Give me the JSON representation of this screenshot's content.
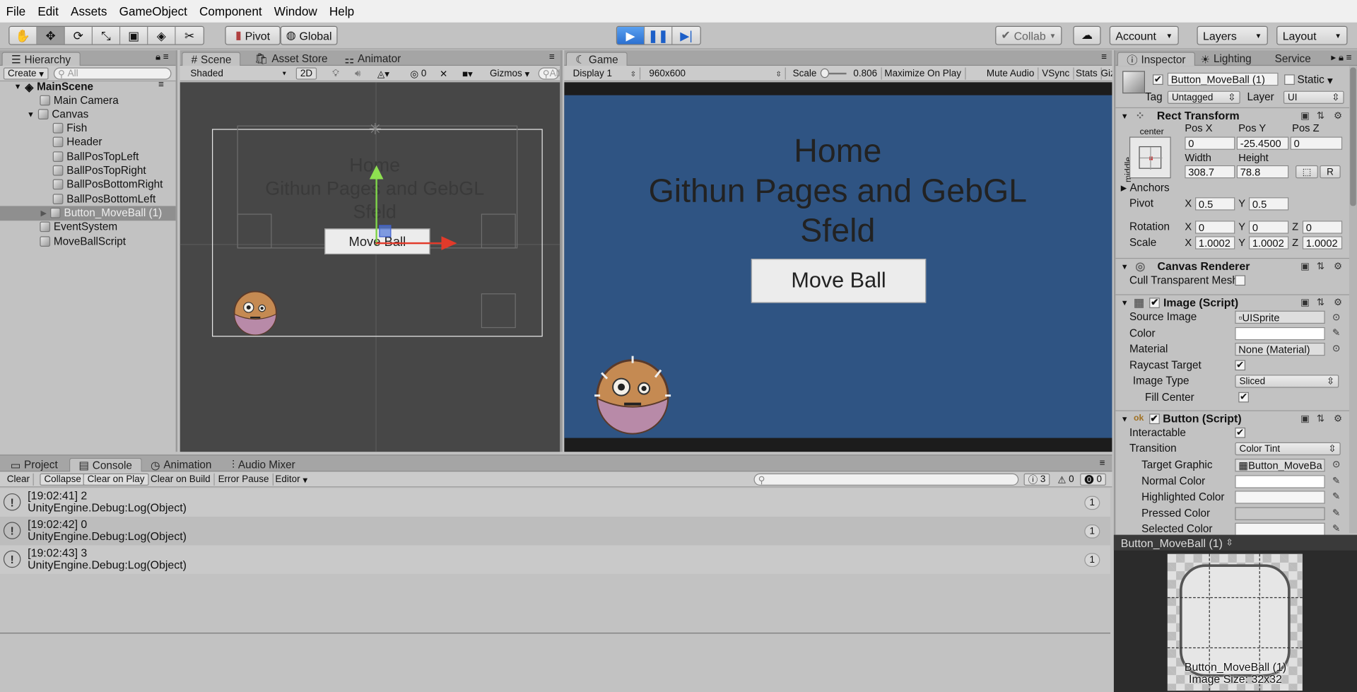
{
  "menu": [
    "File",
    "Edit",
    "Assets",
    "GameObject",
    "Component",
    "Window",
    "Help"
  ],
  "toolbar": {
    "pivot": "Pivot",
    "global": "Global",
    "collab": "Collab",
    "account": "Account",
    "layers": "Layers",
    "layout": "Layout"
  },
  "hierarchy": {
    "tab": "Hierarchy",
    "create": "Create",
    "search_placeholder": "All",
    "items": [
      {
        "label": "MainScene"
      },
      {
        "label": "Main Camera"
      },
      {
        "label": "Canvas"
      },
      {
        "label": "Fish"
      },
      {
        "label": "Header"
      },
      {
        "label": "BallPosTopLeft"
      },
      {
        "label": "BallPosTopRight"
      },
      {
        "label": "BallPosBottomRight"
      },
      {
        "label": "BallPosBottomLeft"
      },
      {
        "label": "Button_MoveBall (1)"
      },
      {
        "label": "EventSystem"
      },
      {
        "label": "MoveBallScript"
      }
    ]
  },
  "scene": {
    "tabs": [
      "Scene",
      "Asset Store",
      "Animator"
    ],
    "shading": "Shaded",
    "mode_2d": "2D",
    "effects_count": "0",
    "gizmos": "Gizmos",
    "search_placeholder": "All",
    "heading_line1": "Home",
    "heading_line2": "Githun Pages and GebGL",
    "heading_line3": "Sfeld",
    "button_label": "Move Ball"
  },
  "game": {
    "tab": "Game",
    "display": "Display 1",
    "resolution": "960x600",
    "scale_label": "Scale",
    "scale_value": "0.806",
    "toggles": [
      "Maximize On Play",
      "Mute Audio",
      "VSync",
      "Stats",
      "Gizmo"
    ],
    "heading_line1": "Home",
    "heading_line2": "Githun Pages and GebGL",
    "heading_line3": "Sfeld",
    "button_label": "Move Ball",
    "bg_color": "#2f5483"
  },
  "console": {
    "tabs": [
      "Project",
      "Console",
      "Animation",
      "Audio Mixer"
    ],
    "buttons": [
      "Clear",
      "Collapse",
      "Clear on Play",
      "Clear on Build",
      "Error Pause",
      "Editor"
    ],
    "counts": {
      "log": "3",
      "warn": "0",
      "error": "0"
    },
    "logs": [
      {
        "time": "[19:02:41] 2",
        "detail": "UnityEngine.Debug:Log(Object)",
        "count": "1"
      },
      {
        "time": "[19:02:42] 0",
        "detail": "UnityEngine.Debug:Log(Object)",
        "count": "1"
      },
      {
        "time": "[19:02:43] 3",
        "detail": "UnityEngine.Debug:Log(Object)",
        "count": "1"
      }
    ]
  },
  "inspector": {
    "tabs": [
      "Inspector",
      "Lighting",
      "Service"
    ],
    "object_name": "Button_MoveBall (1)",
    "static_label": "Static",
    "tag_label": "Tag",
    "tag_value": "Untagged",
    "layer_label": "Layer",
    "layer_value": "UI",
    "rect_transform": {
      "title": "Rect Transform",
      "anchor_h": "center",
      "anchor_v": "middle",
      "posx_label": "Pos X",
      "posy_label": "Pos Y",
      "posz_label": "Pos Z",
      "posx": "0",
      "posy": "-25.4500",
      "posz": "0",
      "width_label": "Width",
      "height_label": "Height",
      "width": "308.7",
      "height": "78.8",
      "r_btn": "R",
      "anchors": "Anchors",
      "pivot": "Pivot",
      "pivot_x": "0.5",
      "pivot_y": "0.5",
      "rotation": "Rotation",
      "rot_x": "0",
      "rot_y": "0",
      "rot_z": "0",
      "scale": "Scale",
      "scale_x": "1.0002",
      "scale_y": "1.0002",
      "scale_z": "1.0002"
    },
    "canvas_renderer": {
      "title": "Canvas Renderer",
      "cull": "Cull Transparent Mesh"
    },
    "image": {
      "title": "Image (Script)",
      "source_image_label": "Source Image",
      "source_image": "UISprite",
      "color_label": "Color",
      "material_label": "Material",
      "material": "None (Material)",
      "raycast": "Raycast Target",
      "image_type_label": "Image Type",
      "image_type": "Sliced",
      "fill_center": "Fill Center"
    },
    "button": {
      "title": "Button (Script)",
      "interactable": "Interactable",
      "transition_label": "Transition",
      "transition": "Color Tint",
      "target_graphic_label": "Target Graphic",
      "target_graphic": "Button_MoveBa",
      "normal": "Normal Color",
      "highlighted": "Highlighted Color",
      "pressed": "Pressed Color",
      "selected": "Selected Color"
    }
  },
  "preview": {
    "title": "Button_MoveBall (1)",
    "caption": "Button_MoveBall (1)",
    "size": "Image Size: 32x32"
  },
  "axis_labels": {
    "x": "X",
    "y": "Y",
    "z": "Z"
  }
}
